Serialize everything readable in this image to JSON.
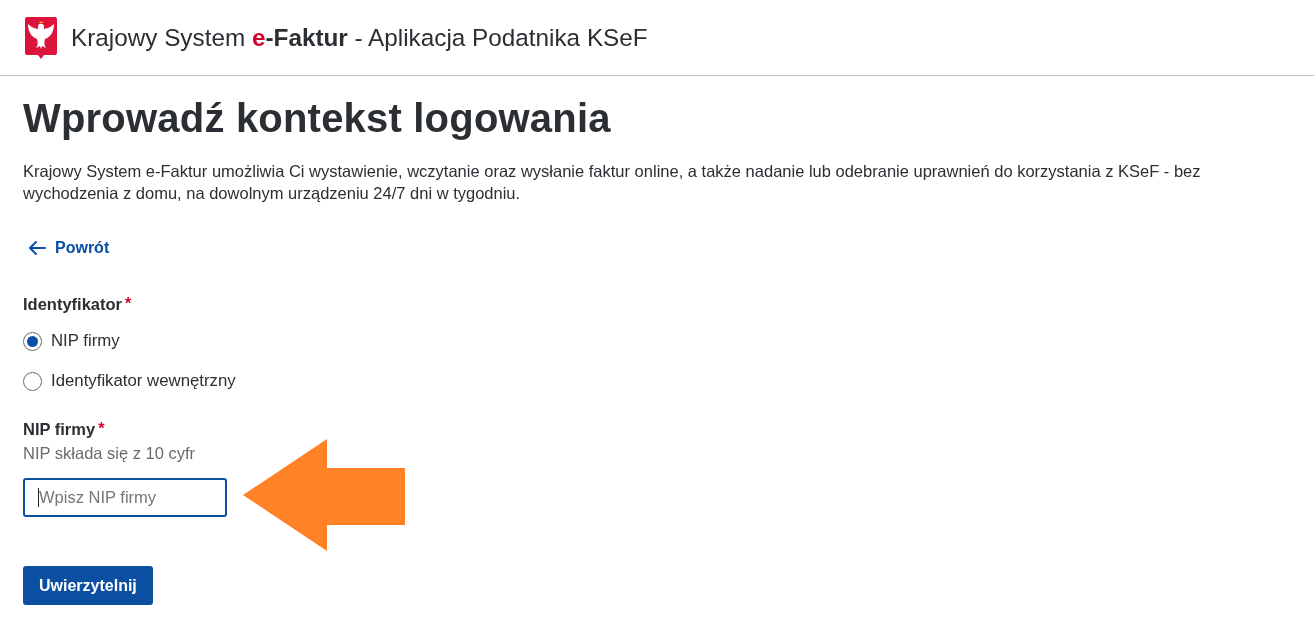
{
  "header": {
    "title_start": "Krajowy System",
    "brand_accent": "e",
    "brand_rest": "-Faktur",
    "title_end": "- Aplikacja Podatnika KSeF"
  },
  "page": {
    "heading": "Wprowadź kontekst logowania",
    "description": "Krajowy System e-Faktur umożliwia Ci wystawienie, wczytanie oraz wysłanie faktur online, a także nadanie lub odebranie uprawnień do korzystania z KSeF - bez wychodzenia z domu, na dowolnym urządzeniu 24/7 dni w tygodniu.",
    "back_link": "Powrót"
  },
  "identifier": {
    "label": "Identyfikator",
    "required_mark": "*",
    "options": [
      {
        "label": "NIP firmy",
        "selected": true
      },
      {
        "label": "Identyfikator wewnętrzny",
        "selected": false
      }
    ]
  },
  "nip_field": {
    "label": "NIP firmy",
    "required_mark": "*",
    "hint": "NIP składa się z 10 cyfr",
    "placeholder": "Wpisz NIP firmy",
    "focused": true
  },
  "submit_button": "Uwierzytelnij",
  "overlay": {
    "kind": "arrow-left"
  }
}
